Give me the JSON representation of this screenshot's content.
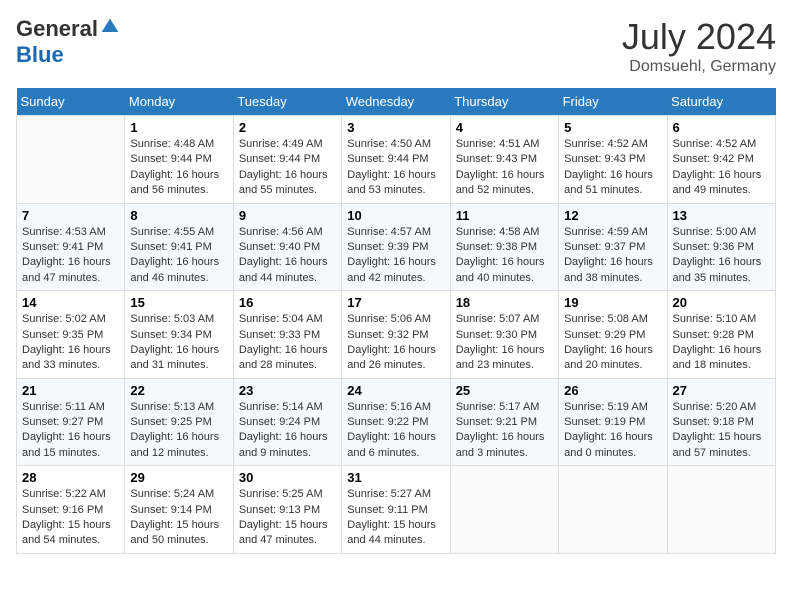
{
  "logo": {
    "general": "General",
    "blue": "Blue"
  },
  "title": {
    "month_year": "July 2024",
    "location": "Domsuehl, Germany"
  },
  "days_of_week": [
    "Sunday",
    "Monday",
    "Tuesday",
    "Wednesday",
    "Thursday",
    "Friday",
    "Saturday"
  ],
  "weeks": [
    [
      {
        "num": "",
        "sunrise": "",
        "sunset": "",
        "daylight": "",
        "empty": true
      },
      {
        "num": "1",
        "sunrise": "Sunrise: 4:48 AM",
        "sunset": "Sunset: 9:44 PM",
        "daylight": "Daylight: 16 hours and 56 minutes.",
        "empty": false
      },
      {
        "num": "2",
        "sunrise": "Sunrise: 4:49 AM",
        "sunset": "Sunset: 9:44 PM",
        "daylight": "Daylight: 16 hours and 55 minutes.",
        "empty": false
      },
      {
        "num": "3",
        "sunrise": "Sunrise: 4:50 AM",
        "sunset": "Sunset: 9:44 PM",
        "daylight": "Daylight: 16 hours and 53 minutes.",
        "empty": false
      },
      {
        "num": "4",
        "sunrise": "Sunrise: 4:51 AM",
        "sunset": "Sunset: 9:43 PM",
        "daylight": "Daylight: 16 hours and 52 minutes.",
        "empty": false
      },
      {
        "num": "5",
        "sunrise": "Sunrise: 4:52 AM",
        "sunset": "Sunset: 9:43 PM",
        "daylight": "Daylight: 16 hours and 51 minutes.",
        "empty": false
      },
      {
        "num": "6",
        "sunrise": "Sunrise: 4:52 AM",
        "sunset": "Sunset: 9:42 PM",
        "daylight": "Daylight: 16 hours and 49 minutes.",
        "empty": false
      }
    ],
    [
      {
        "num": "7",
        "sunrise": "Sunrise: 4:53 AM",
        "sunset": "Sunset: 9:41 PM",
        "daylight": "Daylight: 16 hours and 47 minutes.",
        "empty": false
      },
      {
        "num": "8",
        "sunrise": "Sunrise: 4:55 AM",
        "sunset": "Sunset: 9:41 PM",
        "daylight": "Daylight: 16 hours and 46 minutes.",
        "empty": false
      },
      {
        "num": "9",
        "sunrise": "Sunrise: 4:56 AM",
        "sunset": "Sunset: 9:40 PM",
        "daylight": "Daylight: 16 hours and 44 minutes.",
        "empty": false
      },
      {
        "num": "10",
        "sunrise": "Sunrise: 4:57 AM",
        "sunset": "Sunset: 9:39 PM",
        "daylight": "Daylight: 16 hours and 42 minutes.",
        "empty": false
      },
      {
        "num": "11",
        "sunrise": "Sunrise: 4:58 AM",
        "sunset": "Sunset: 9:38 PM",
        "daylight": "Daylight: 16 hours and 40 minutes.",
        "empty": false
      },
      {
        "num": "12",
        "sunrise": "Sunrise: 4:59 AM",
        "sunset": "Sunset: 9:37 PM",
        "daylight": "Daylight: 16 hours and 38 minutes.",
        "empty": false
      },
      {
        "num": "13",
        "sunrise": "Sunrise: 5:00 AM",
        "sunset": "Sunset: 9:36 PM",
        "daylight": "Daylight: 16 hours and 35 minutes.",
        "empty": false
      }
    ],
    [
      {
        "num": "14",
        "sunrise": "Sunrise: 5:02 AM",
        "sunset": "Sunset: 9:35 PM",
        "daylight": "Daylight: 16 hours and 33 minutes.",
        "empty": false
      },
      {
        "num": "15",
        "sunrise": "Sunrise: 5:03 AM",
        "sunset": "Sunset: 9:34 PM",
        "daylight": "Daylight: 16 hours and 31 minutes.",
        "empty": false
      },
      {
        "num": "16",
        "sunrise": "Sunrise: 5:04 AM",
        "sunset": "Sunset: 9:33 PM",
        "daylight": "Daylight: 16 hours and 28 minutes.",
        "empty": false
      },
      {
        "num": "17",
        "sunrise": "Sunrise: 5:06 AM",
        "sunset": "Sunset: 9:32 PM",
        "daylight": "Daylight: 16 hours and 26 minutes.",
        "empty": false
      },
      {
        "num": "18",
        "sunrise": "Sunrise: 5:07 AM",
        "sunset": "Sunset: 9:30 PM",
        "daylight": "Daylight: 16 hours and 23 minutes.",
        "empty": false
      },
      {
        "num": "19",
        "sunrise": "Sunrise: 5:08 AM",
        "sunset": "Sunset: 9:29 PM",
        "daylight": "Daylight: 16 hours and 20 minutes.",
        "empty": false
      },
      {
        "num": "20",
        "sunrise": "Sunrise: 5:10 AM",
        "sunset": "Sunset: 9:28 PM",
        "daylight": "Daylight: 16 hours and 18 minutes.",
        "empty": false
      }
    ],
    [
      {
        "num": "21",
        "sunrise": "Sunrise: 5:11 AM",
        "sunset": "Sunset: 9:27 PM",
        "daylight": "Daylight: 16 hours and 15 minutes.",
        "empty": false
      },
      {
        "num": "22",
        "sunrise": "Sunrise: 5:13 AM",
        "sunset": "Sunset: 9:25 PM",
        "daylight": "Daylight: 16 hours and 12 minutes.",
        "empty": false
      },
      {
        "num": "23",
        "sunrise": "Sunrise: 5:14 AM",
        "sunset": "Sunset: 9:24 PM",
        "daylight": "Daylight: 16 hours and 9 minutes.",
        "empty": false
      },
      {
        "num": "24",
        "sunrise": "Sunrise: 5:16 AM",
        "sunset": "Sunset: 9:22 PM",
        "daylight": "Daylight: 16 hours and 6 minutes.",
        "empty": false
      },
      {
        "num": "25",
        "sunrise": "Sunrise: 5:17 AM",
        "sunset": "Sunset: 9:21 PM",
        "daylight": "Daylight: 16 hours and 3 minutes.",
        "empty": false
      },
      {
        "num": "26",
        "sunrise": "Sunrise: 5:19 AM",
        "sunset": "Sunset: 9:19 PM",
        "daylight": "Daylight: 16 hours and 0 minutes.",
        "empty": false
      },
      {
        "num": "27",
        "sunrise": "Sunrise: 5:20 AM",
        "sunset": "Sunset: 9:18 PM",
        "daylight": "Daylight: 15 hours and 57 minutes.",
        "empty": false
      }
    ],
    [
      {
        "num": "28",
        "sunrise": "Sunrise: 5:22 AM",
        "sunset": "Sunset: 9:16 PM",
        "daylight": "Daylight: 15 hours and 54 minutes.",
        "empty": false
      },
      {
        "num": "29",
        "sunrise": "Sunrise: 5:24 AM",
        "sunset": "Sunset: 9:14 PM",
        "daylight": "Daylight: 15 hours and 50 minutes.",
        "empty": false
      },
      {
        "num": "30",
        "sunrise": "Sunrise: 5:25 AM",
        "sunset": "Sunset: 9:13 PM",
        "daylight": "Daylight: 15 hours and 47 minutes.",
        "empty": false
      },
      {
        "num": "31",
        "sunrise": "Sunrise: 5:27 AM",
        "sunset": "Sunset: 9:11 PM",
        "daylight": "Daylight: 15 hours and 44 minutes.",
        "empty": false
      },
      {
        "num": "",
        "sunrise": "",
        "sunset": "",
        "daylight": "",
        "empty": true
      },
      {
        "num": "",
        "sunrise": "",
        "sunset": "",
        "daylight": "",
        "empty": true
      },
      {
        "num": "",
        "sunrise": "",
        "sunset": "",
        "daylight": "",
        "empty": true
      }
    ]
  ]
}
